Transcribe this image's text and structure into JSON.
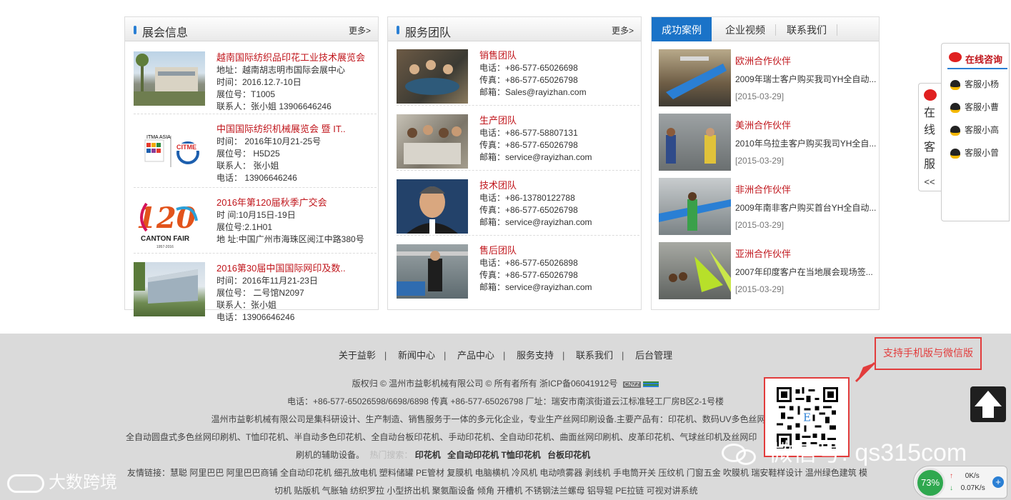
{
  "exhibition": {
    "title": "展会信息",
    "more": "更多>",
    "items": [
      {
        "name": "越南国际纺织品印花工业技术展览会",
        "lines": [
          "地址：越南胡志明市国际会展中心",
          "时间：2016.12.7-10日",
          "展位号：T1005",
          "联系人：张小姐 13906646246"
        ]
      },
      {
        "name": "中国国际纺织机械展览会 暨 IT..",
        "lines": [
          "时间： 2016年10月21-25号",
          "展位号： H5D25",
          "联系人： 张小姐",
          "电话： 13906646246"
        ]
      },
      {
        "name": "2016年第120届秋季广交会",
        "lines": [
          "时 间:10月15日-19日",
          "展位号:2.1H01",
          "地 址:中国广州市海珠区阅江中路380号"
        ]
      },
      {
        "name": "2016第30届中国国际网印及数..",
        "lines": [
          "时间：2016年11月21-23日",
          "展位号： 二号馆N2097",
          "联系人：张小姐",
          "电话：13906646246"
        ]
      }
    ],
    "logos": {
      "itma": "ITMA ASIA",
      "citme": "CITME",
      "canton_num": "120",
      "canton": "CANTON FAIR",
      "canton_years": "1957-2016"
    }
  },
  "service": {
    "title": "服务团队",
    "more": "更多>",
    "items": [
      {
        "name": "销售团队",
        "lines": [
          "电话：+86-577-65026698",
          "传真：+86-577-65026798",
          "邮箱：Sales@rayizhan.com"
        ]
      },
      {
        "name": "生产团队",
        "lines": [
          "电话：+86-577-58807131",
          "传真：+86-577-65026798",
          "邮箱：service@rayizhan.com"
        ]
      },
      {
        "name": "技术团队",
        "lines": [
          "电话：+86-13780122788",
          "传真：+86-577-65026798",
          "邮箱：service@rayizhan.com"
        ]
      },
      {
        "name": "售后团队",
        "lines": [
          "电话：+86-577-65026898",
          "传真：+86-577-65026798",
          "邮箱：service@rayizhan.com"
        ]
      }
    ]
  },
  "cases": {
    "tabs": [
      "成功案例",
      "企业视频",
      "联系我们"
    ],
    "items": [
      {
        "title": "欧洲合作伙伴",
        "desc": "2009年瑞士客户购买我司YH全自动...",
        "date": "[2015-03-29]"
      },
      {
        "title": "美洲合作伙伴",
        "desc": "2010年乌拉圭客户购买我司YH全自...",
        "date": "[2015-03-29]"
      },
      {
        "title": "非洲合作伙伴",
        "desc": "2009年南非客户购买首台YH全自动...",
        "date": "[2015-03-29]"
      },
      {
        "title": "亚洲合作伙伴",
        "desc": "2007年印度客户在当地展会现场签...",
        "date": "[2015-03-29]"
      }
    ]
  },
  "chat": {
    "title": "在线咨询",
    "tab_chars": [
      "在",
      "线",
      "客",
      "服"
    ],
    "tab_collapse": "<<",
    "agents": [
      "客服小杨",
      "客服小曹",
      "客服小高",
      "客服小曾"
    ]
  },
  "footer": {
    "nav": [
      "关于益彰",
      "新闻中心",
      "产品中心",
      "服务支持",
      "联系我们",
      "后台管理"
    ],
    "copyright": "版权归 © 温州市益彰机械有限公司 © 所有者所有  浙ICP备06041912号",
    "cnzz": "CNZZ",
    "contact": "电话：+86-577-65026598/6698/6898  传真 +86-577-65026798  厂址：瑞安市南滨街道云江标准轻工厂房B区2-1号楼",
    "intro1": "温州市益彰机械有限公司是集科研设计、生产制造、销售服务于一体的多元化企业，专业生产丝网印刷设备.主要产品有：印花机、数码UV多色丝网印刷机、",
    "intro2": "全自动圆盘式多色丝网印刷机、T恤印花机、半自动多色印花机、全自动台板印花机、手动印花机、全自动印花机、曲面丝网印刷机、皮革印花机、气球丝印机及丝网印",
    "intro3": "刷机的辅助设备。",
    "hot_label": "热门搜索：",
    "hot_items": [
      "印花机",
      "全自动印花机",
      "T恤印花机",
      "台板印花机"
    ],
    "links1": "友情链接：慧聪 阿里巴巴 阿里巴巴商铺 全自动印花机 细孔放电机 塑料储罐 PE管材 复膜机 电脑横机 冷风机 电动喷雾器 剥线机 手电筒开关 压纹机 门窗五金 吹膜机 瑞安鞋样设计 温州绿色建筑 模",
    "links2": "切机 贴版机 气胀轴 纺织罗拉 小型挤出机 聚氨酯设备 倾角 开槽机 不锈钢法兰螺母 铝导辊 PE拉链 可视对讲系统",
    "qr_note": "支持手机版与微信版",
    "wechat": "微信号: qs315com",
    "brand": "大数跨境"
  },
  "net_widget": {
    "percent": "73%",
    "up": "0K/s",
    "down": "0.07K/s"
  }
}
